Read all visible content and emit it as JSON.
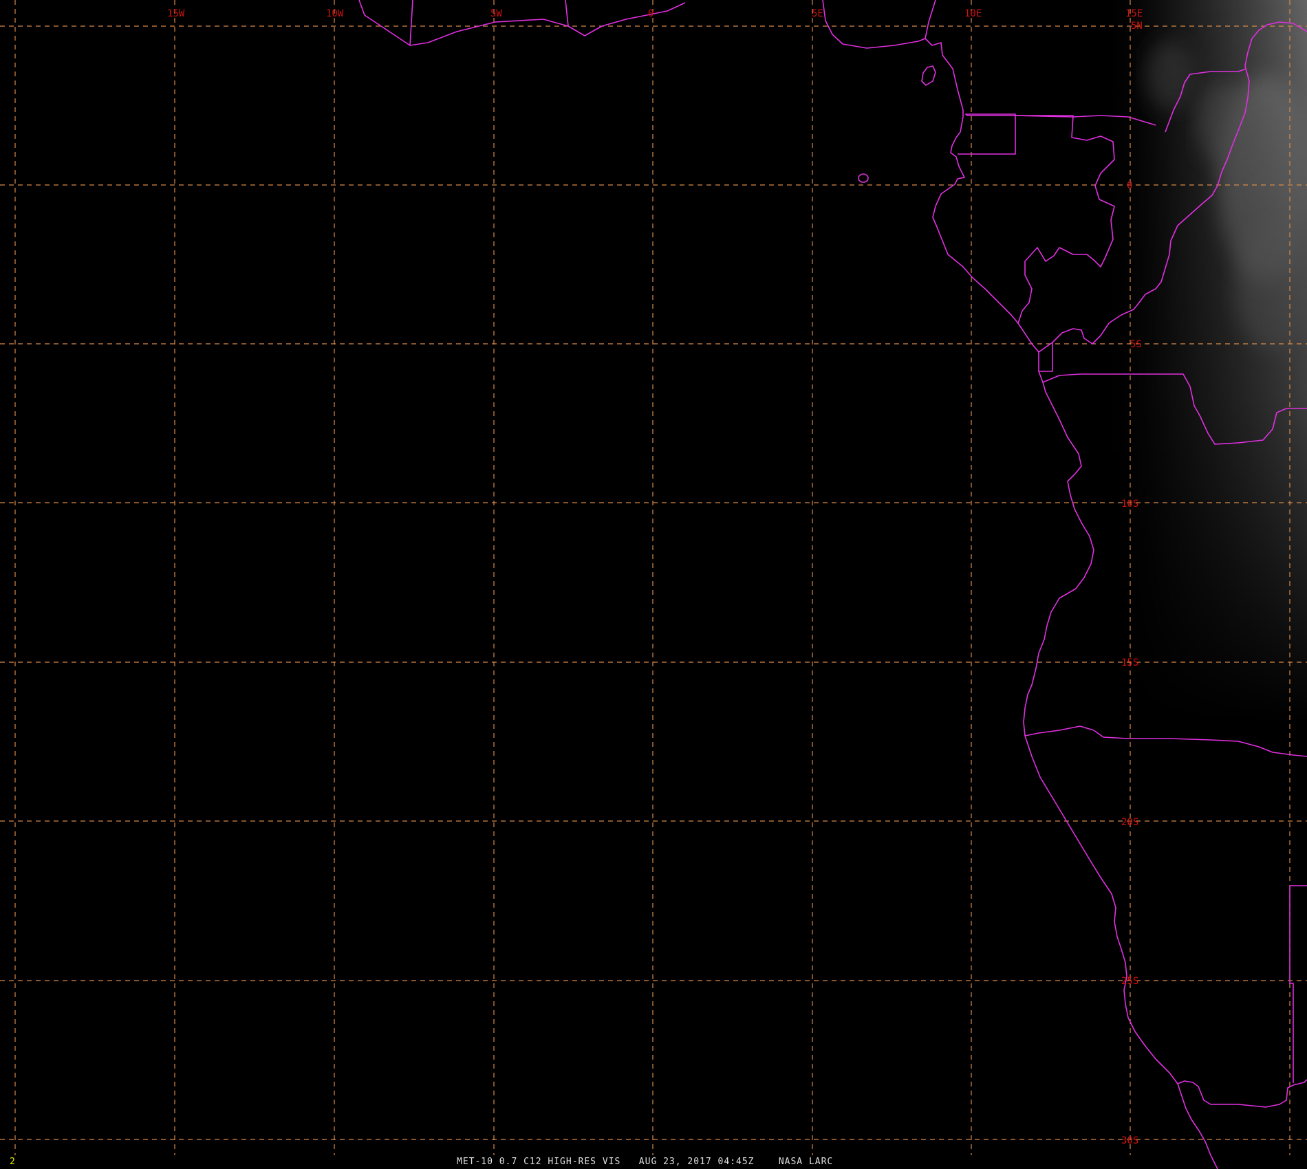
{
  "image": {
    "caption": "MET-10 0.7 C12 HIGH-RES VIS   AUG 23, 2017 04:45Z    NASA LARC",
    "frame_number": "2"
  },
  "colors": {
    "background": "#000000",
    "grid": "#d88a4a",
    "grid_label": "#d01010",
    "boundary": "#e030e0",
    "frame_number": "#e8e800",
    "caption": "#e0e0e0"
  },
  "grid": {
    "longitude_labels": [
      "15W",
      "10W",
      "5W",
      "0",
      "5E",
      "10E",
      "15E"
    ],
    "latitude_labels": [
      "5N",
      "0",
      "5S",
      "10S",
      "15S",
      "20S",
      "25S",
      "30S"
    ]
  }
}
